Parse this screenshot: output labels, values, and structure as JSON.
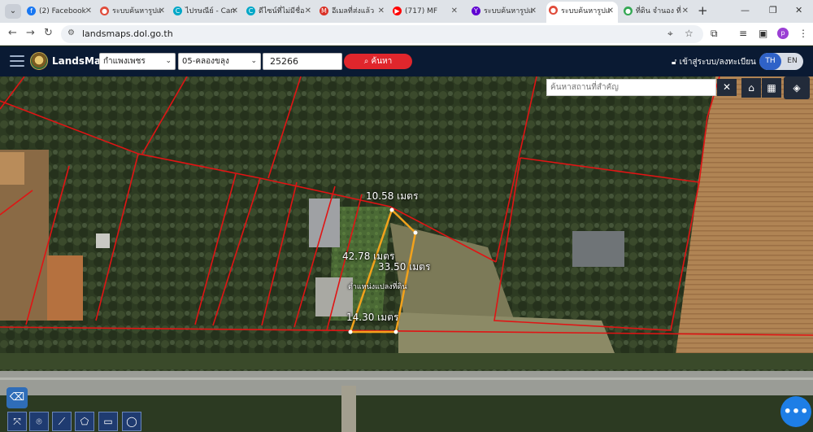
{
  "browser": {
    "tabs": [
      {
        "title": "(2) Facebook",
        "icon": "facebook-icon",
        "color": "#1877f2",
        "glyph": "f"
      },
      {
        "title": "ระบบค้นหารูปแ",
        "icon": "maps-pin-icon",
        "color": "#e04b3a",
        "glyph": "●"
      },
      {
        "title": "ไปรษณีย์ - Can",
        "icon": "canva-icon",
        "color": "#00a7c7",
        "glyph": "C"
      },
      {
        "title": "ดีไซน์ที่ไม่มีชื่อ",
        "icon": "canva-icon",
        "color": "#00a7c7",
        "glyph": "C"
      },
      {
        "title": "อีเมลที่ส่งแล้ว",
        "icon": "gmail-icon",
        "color": "#d93025",
        "glyph": "M"
      },
      {
        "title": "(717) MF",
        "icon": "youtube-icon",
        "color": "#ff0000",
        "glyph": "▶"
      },
      {
        "title": "ระบบค้นหารูปแ",
        "icon": "yahoo-icon",
        "color": "#6001d2",
        "glyph": "Y"
      },
      {
        "title": "ระบบค้นหารูปแ",
        "icon": "maps-pin-icon",
        "color": "#e04b3a",
        "glyph": "●"
      },
      {
        "title": "ที่ดิน จำนอง ที่",
        "icon": "google-maps-icon",
        "color": "#34a853",
        "glyph": "●"
      }
    ],
    "active_tab": 7,
    "url": "landsmaps.dol.go.th"
  },
  "app": {
    "name": "LandsMaps",
    "province": "กำแพงเพชร",
    "district": "05-คลองขลุง",
    "parcel_no": "25266",
    "search_label": "ค้นหา",
    "login_label": "เข้าสู่ระบบ/ลงทะเบียน",
    "lang_th": "TH",
    "lang_en": "EN",
    "map_search_placeholder": "ค้นหาสถานที่สำคัญ"
  },
  "measurements": {
    "top": "10.58 เมตร",
    "left": "42.78 เมตร",
    "right": "33.50 เมตร",
    "bottom": "14.30 เมตร",
    "parcel_note": "ตำแหน่งแปลงที่ดิน"
  },
  "colors": {
    "accent": "#2f62c8",
    "search_button": "#e0262c",
    "boundary": "#e01414",
    "parcel_outline": "#f2a21c",
    "header": "#0a1a33"
  }
}
